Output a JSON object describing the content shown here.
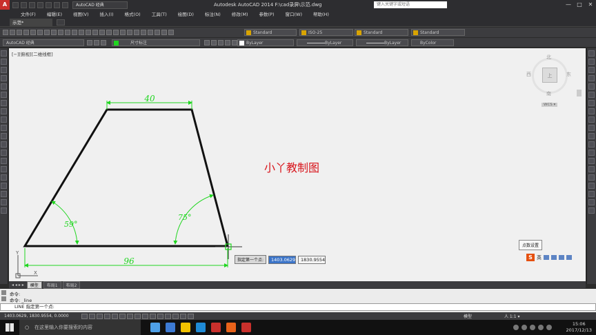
{
  "titlebar": {
    "app_icon": "A",
    "workspace": "AutoCAD 经典",
    "title": "Autodesk AutoCAD 2014    F:\\cad录屏\\示范.dwg",
    "search_placeholder": "键入关键字或短语",
    "minimize": "—",
    "maximize": "□",
    "close": "✕"
  },
  "menu": [
    "文件(F)",
    "编辑(E)",
    "视图(V)",
    "插入(I)",
    "格式(O)",
    "工具(T)",
    "绘图(D)",
    "标注(N)",
    "修改(M)",
    "参数(P)",
    "窗口(W)",
    "帮助(H)"
  ],
  "file_tab": "示范*",
  "toolbar1": {
    "text_style": "Standard",
    "dim_style": "ISO-25",
    "table_style": "Standard",
    "multileader_style": "Standard"
  },
  "toolbar2": {
    "workspace": "AutoCAD 经典",
    "layer": "尺寸标注",
    "color": "ByLayer",
    "linetype": "ByLayer",
    "lineweight": "ByLayer",
    "plotstyle": "ByColor"
  },
  "viewport": {
    "label": "[−][俯视][二维线框]"
  },
  "viewcube": {
    "north": "北",
    "south": "南",
    "east": "东",
    "west": "西",
    "top": "上",
    "wcs": "WCS ▾"
  },
  "drawing": {
    "dim_top": "40",
    "dim_bottom": "96",
    "angle_left": "59°",
    "angle_right": "75°",
    "ucs_y": "Y",
    "ucs_x": "X",
    "watermark": "小丫教制图",
    "line_color": "#111111",
    "dim_color": "#1fd61f",
    "watermark_color": "#d8141b"
  },
  "prompt": {
    "label": "指定第一个点:",
    "x": "1403.0629",
    "y": "1830.9554"
  },
  "tooltip": "点数设置",
  "ime": {
    "logo": "S",
    "lang": "英"
  },
  "layout_tabs": {
    "nav": "◂ ◂ ▸ ▸",
    "tabs": [
      "模型",
      "布局1",
      "布局2"
    ]
  },
  "command": {
    "history1": "命令:",
    "history2": "命令: _line",
    "current": "LINE 指定第一个点:"
  },
  "status": {
    "coords": "1403.0629, 1830.9554, 0.0000",
    "model": "模型",
    "scale": "人 1:1 ▾"
  },
  "taskbar": {
    "search": "在这里输入你要搜索的内容",
    "time": "15:06",
    "date": "2017/12/13",
    "app_colors": [
      "#4ea0e8",
      "#3d7bd4",
      "#f2c200",
      "#1f8bd6",
      "#c9302c",
      "#e8621a",
      "#c9302c"
    ]
  }
}
